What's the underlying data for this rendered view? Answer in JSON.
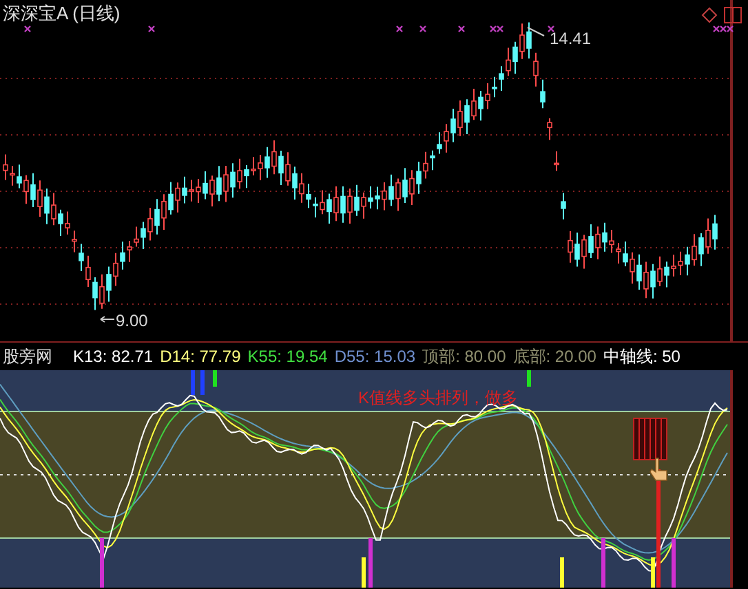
{
  "chart_title": "深深宝A (日线)",
  "price_labels": {
    "high": "14.41",
    "low": "9.00"
  },
  "indicator": {
    "name": "股旁网",
    "legend": [
      {
        "text": "K13: 82.71",
        "color": "#ffffff"
      },
      {
        "text": "D14: 77.79",
        "color": "#ffff80"
      },
      {
        "text": "K55: 19.54",
        "color": "#40e040"
      },
      {
        "text": "D55: 15.03",
        "color": "#7090d0"
      },
      {
        "text": "顶部: 80.00",
        "color": "#909070"
      },
      {
        "text": "底部: 20.00",
        "color": "#909070"
      },
      {
        "text": "中轴线: 50",
        "color": "#ffffff"
      }
    ],
    "annotation": "K值线多头排列，做多"
  }
}
